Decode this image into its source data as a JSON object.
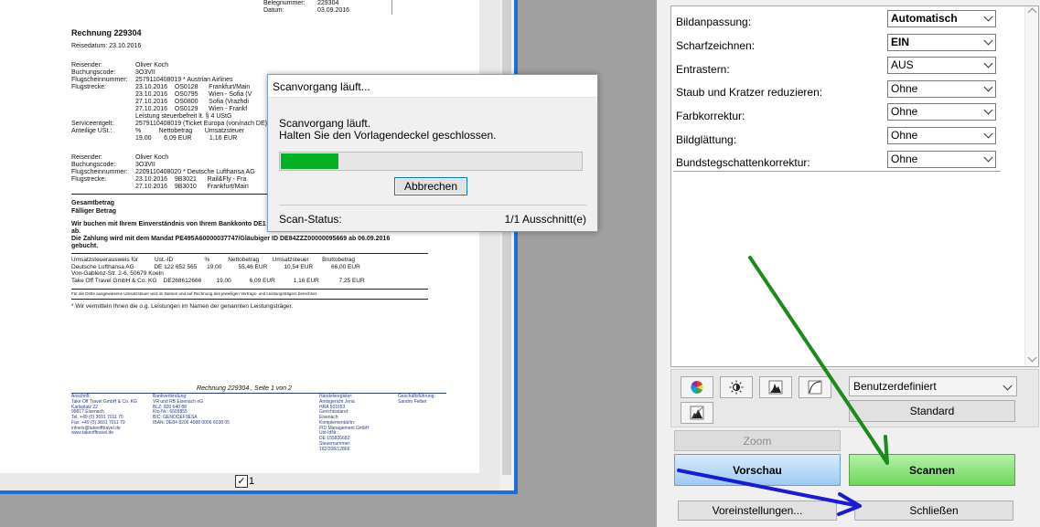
{
  "document": {
    "hdr_beleg_label": "Belegnummer:",
    "hdr_beleg_value": "229304",
    "hdr_datum_label": "Datum:",
    "hdr_datum_value": "03.09.2016",
    "title": "Rechnung 229304",
    "reisedatum": "Reisedatum: 23.10.2016",
    "block1": {
      "reisender_l": "Reisender:",
      "reisender_v": "Oliver Koch",
      "buchung_l": "Buchungscode:",
      "buchung_v": "3O3VII",
      "flugschein_l": "Flugscheinnummer:",
      "flugschein_v": "2579110408019 * Austrian Airlines",
      "flugstrecke_l": "Flugstrecke:",
      "legs": [
        "23.10.2016    OS0128      Frankfurt/Main",
        "23.10.2016    OS0795      Wien - Sofia (V",
        "27.10.2016    OS0800      Sofia (Vrazhdi",
        "27.10.2016    OS0129      Wien - Frankf"
      ],
      "leistung": "Leistung steuerbefreit lt. § 4 UStG",
      "service_l": "Serviceentgelt:",
      "service_v": "2579110408019 (Ticket Europa (von/nach DE)",
      "anteil_l": "Anteilige USt.:",
      "anteil_hdr": "%          Nettobetrag       Umsatzsteuer",
      "anteil_row": "19.00       6,09 EUR          1,16 EUR"
    },
    "block2": {
      "reisender_l": "Reisender:",
      "reisender_v": "Oliver Koch",
      "buchung_l": "Buchungscode:",
      "buchung_v": "3O3VII",
      "flugschein_l": "Flugscheinnummer:",
      "flugschein_v": "2209110408020 * Deutsche Lufthansa AG",
      "flugstrecke_l": "Flugstrecke:",
      "legs": [
        "23.10.2016    9B3021      Rail&Fly - Fra",
        "27.10.2016    9B3010      Frankfurt/Main"
      ]
    },
    "gesamt": "Gesamtbetrag",
    "faellig": "Fälliger Betrag",
    "einzug": "Wir buchen mit Ihrem Einverständnis von Ihrem Bankkonto DE1",
    "einzug2": "ab.",
    "mandat": "Die Zahlung wird mit dem Mandat PE495A60000037747/Gläubiger ID DE84ZZZ00000095669 ab 06.09.2016",
    "mandat2": "gebucht.",
    "tax_header": "Umsatzsteuerausweis für          Ust.-ID                   %           Nettobetrag        Umsatzsteuer        Bruttobetrag",
    "tax_row1": "Deutsche Lufthansa AG            DE 122 652 565      19.00          55,46 EUR          10,54 EUR           66,00 EUR",
    "tax_row1b": "Von-Gablenz-Str. 2-6, 50679 Koeln",
    "tax_row2": "Take Off Travel GmbH & Co. KG    DE268612666         19.00           6,09 EUR           1,16 EUR            7,25 EUR",
    "fineprint": "Für die Dritte ausgewiesene Umsatzsteuer wird im Namen und auf Rechnung des jeweiligen Vertrags- und Leistungsträgers berechnet.",
    "vermittlung": "* Wir vermitteln Ihnen die o.g. Leistungen im Namen der genannten Leistungsträger.",
    "footer_title": "Rechnung 229304 , Seite 1 von 2",
    "footer_cols": [
      "Anschrift:\nTake Off Travel GmbH & Co. KG\nKarlsplatz 22\n99817 Eisenach\nTel. +49 (0) 3691 7011 70\nFax: +49 (0) 3691 7011 79\ninfoeis@takeofftravel.de\nwww.takeofftravel.de",
      "Bankverbindung:\nVR und RB Eisenach eG\nBLZ: 820 640 88\nKto-Nr.: 6603855\nBIC: GENODEF1ESA\nIBAN: DE84 8206 4088 0006 6038 05",
      "Handelsregister:\nAmtsgericht Jena\nHRA 501653\nGerichtsstand:\nEisenach\nKomplementär/in:\nFID Management GmbH\nUst-IdNr.:\nDE 155826682\nSteuernummer:\n162/208/12866",
      "Geschäftsführung:\nSandro Felber"
    ],
    "page_number": "1",
    "page_checked": "✓"
  },
  "dialog": {
    "title": "Scanvorgang läuft...",
    "message1": "Scanvorgang läuft.",
    "message2": "Halten Sie den Vorlagendeckel geschlossen.",
    "progress": 0.19,
    "cancel_label": "Abbrechen",
    "status_label": "Scan-Status:",
    "status_value": "1/1 Ausschnitt(e)"
  },
  "settings": [
    {
      "label": "Bildanpassung:",
      "value": "Automatisch",
      "bold": true
    },
    {
      "label": "Scharfzeichnen:",
      "value": "EIN",
      "bold": true
    },
    {
      "label": "Entrastern:",
      "value": "AUS",
      "bold": false
    },
    {
      "label": "Staub und Kratzer reduzieren:",
      "value": "Ohne",
      "bold": false
    },
    {
      "label": "Farbkorrektur:",
      "value": "Ohne",
      "bold": false
    },
    {
      "label": "Bildglättung:",
      "value": "Ohne",
      "bold": false
    },
    {
      "label": "Bundstegschattenkorrektur:",
      "value": "Ohne",
      "bold": false
    }
  ],
  "tools": {
    "icons": [
      "color-wheel-icon",
      "brightness-icon",
      "histogram-icon",
      "tone-curve-icon",
      "levels-icon"
    ],
    "preset_value": "Benutzerdefiniert",
    "standard_label": "Standard"
  },
  "buttons": {
    "zoom": "Zoom",
    "preview": "Vorschau",
    "scan": "Scannen",
    "presets": "Voreinstellungen...",
    "close": "Schließen"
  },
  "colors": {
    "progress": "#06b025",
    "frame": "#1e6fd1",
    "arrow_green": "#1e8a1e",
    "arrow_blue": "#1a1ad6"
  }
}
